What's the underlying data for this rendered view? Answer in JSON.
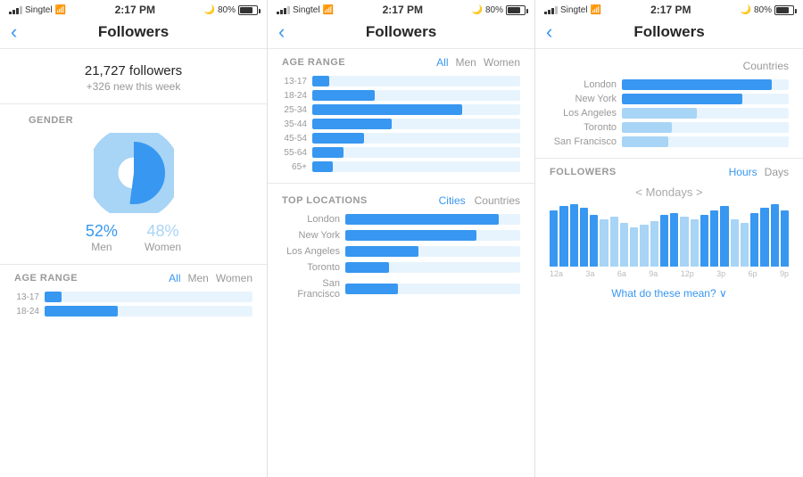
{
  "panels": [
    {
      "id": "panel1",
      "statusBar": {
        "carrier": "Singtel",
        "time": "2:17 PM",
        "battery": "80%"
      },
      "navTitle": "Followers",
      "followersCount": "21,727 followers",
      "followersNew": "+326 new this week",
      "genderLabel": "GENDER",
      "genderPct": [
        "52%",
        "48%"
      ],
      "genderNames": [
        "Men",
        "Women"
      ],
      "ageRangeLabel": "AGE RANGE",
      "filterTabs": [
        "All",
        "Men",
        "Women"
      ],
      "ageRanges": [
        {
          "label": "13-17",
          "pct": 8
        },
        {
          "label": "18-24",
          "pct": 35
        }
      ]
    },
    {
      "id": "panel2",
      "statusBar": {
        "carrier": "Singtel",
        "time": "2:17 PM",
        "battery": "80%"
      },
      "navTitle": "Followers",
      "ageRangeLabel": "AGE RANGE",
      "filterTabs": [
        "All",
        "Men",
        "Women"
      ],
      "ageRanges": [
        {
          "label": "13-17",
          "pct": 8
        },
        {
          "label": "18-24",
          "pct": 30
        },
        {
          "label": "25-34",
          "pct": 72
        },
        {
          "label": "35-44",
          "pct": 38
        },
        {
          "label": "45-54",
          "pct": 25
        },
        {
          "label": "55-64",
          "pct": 15
        },
        {
          "label": "65+",
          "pct": 10
        }
      ],
      "topLocationsLabel": "TOP LOCATIONS",
      "locationTabs": [
        "Cities",
        "Countries"
      ],
      "locations": [
        {
          "name": "London",
          "pct": 88
        },
        {
          "name": "New York",
          "pct": 75
        },
        {
          "name": "Los Angeles",
          "pct": 42
        },
        {
          "name": "Toronto",
          "pct": 25
        },
        {
          "name": "San Francisco",
          "pct": 30
        }
      ]
    },
    {
      "id": "panel3",
      "statusBar": {
        "carrier": "Singtel",
        "time": "2:17 PM",
        "battery": "80%"
      },
      "navTitle": "Followers",
      "cities": [
        {
          "name": "London",
          "pct": 90,
          "light": false
        },
        {
          "name": "New York",
          "pct": 72,
          "light": false
        },
        {
          "name": "Los Angeles",
          "pct": 45,
          "light": true
        },
        {
          "name": "Toronto",
          "pct": 30,
          "light": true
        },
        {
          "name": "San Francisco",
          "pct": 28,
          "light": true
        }
      ],
      "countriesLabel": "Countries",
      "followersLabel": "FOLLOWERS",
      "timeTabs": [
        "Hours",
        "Days"
      ],
      "mondaysLabel": "< Mondays >",
      "histogramBars": [
        65,
        70,
        72,
        68,
        60,
        55,
        58,
        50,
        45,
        48,
        52,
        60,
        62,
        58,
        55,
        60,
        65,
        70,
        55,
        50,
        62,
        68,
        72,
        65
      ],
      "timeLabels": [
        "12a",
        "3a",
        "6a",
        "9a",
        "12p",
        "3p",
        "6p",
        "9p"
      ],
      "whatMean": "What do these mean? ∨"
    }
  ]
}
